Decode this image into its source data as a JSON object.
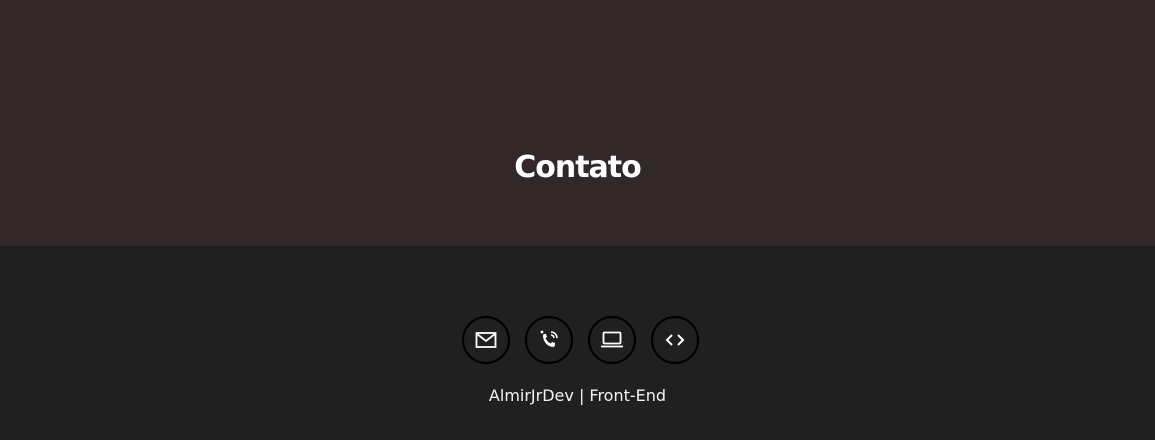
{
  "contact": {
    "title": "Contato"
  },
  "footer": {
    "icons": [
      {
        "name": "mail-icon"
      },
      {
        "name": "phone-call-icon"
      },
      {
        "name": "laptop-icon"
      },
      {
        "name": "code-icon"
      }
    ],
    "credit": "AlmirJrDev | Front-End"
  },
  "colors": {
    "contact_bg": "#332829",
    "footer_bg": "#202020",
    "text": "#ffffff"
  }
}
